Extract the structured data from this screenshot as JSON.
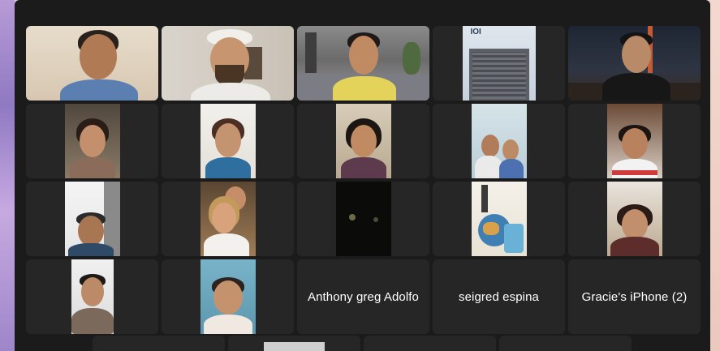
{
  "gallery": {
    "tiles": [
      {
        "kind": "video",
        "scene": "man-smiling-beige-wall"
      },
      {
        "kind": "video",
        "scene": "bearded-man-white-cap",
        "active": true
      },
      {
        "kind": "video",
        "scene": "woman-modern-living-room"
      },
      {
        "kind": "video",
        "scene": "hotel-building-background",
        "logo": "IOI"
      },
      {
        "kind": "video",
        "scene": "man-glasses-night-city"
      },
      {
        "kind": "video",
        "scene": "woman-portrait-phone"
      },
      {
        "kind": "video",
        "scene": "woman-glasses-blue-top"
      },
      {
        "kind": "video",
        "scene": "woman-dark-hair-indoor"
      },
      {
        "kind": "video",
        "scene": "two-people-sofa"
      },
      {
        "kind": "video",
        "scene": "woman-white-shirt"
      },
      {
        "kind": "video",
        "scene": "man-portrait-phone"
      },
      {
        "kind": "video",
        "scene": "two-women-restaurant"
      },
      {
        "kind": "video",
        "scene": "dark-video"
      },
      {
        "kind": "video",
        "scene": "travel-globe-illustration"
      },
      {
        "kind": "video",
        "scene": "woman-glasses-hand-on-chest"
      },
      {
        "kind": "video",
        "scene": "young-man-portrait"
      },
      {
        "kind": "video",
        "scene": "older-woman-glasses-blue-wall"
      },
      {
        "kind": "name",
        "name": "Anthony greg Adolfo"
      },
      {
        "kind": "name",
        "name": "seigred espina"
      },
      {
        "kind": "name",
        "name": "Gracie's iPhone (2)"
      }
    ]
  },
  "colors": {
    "active_speaker_border": "#38c446",
    "tile_background": "#262626",
    "window_background": "#1b1b1b"
  }
}
